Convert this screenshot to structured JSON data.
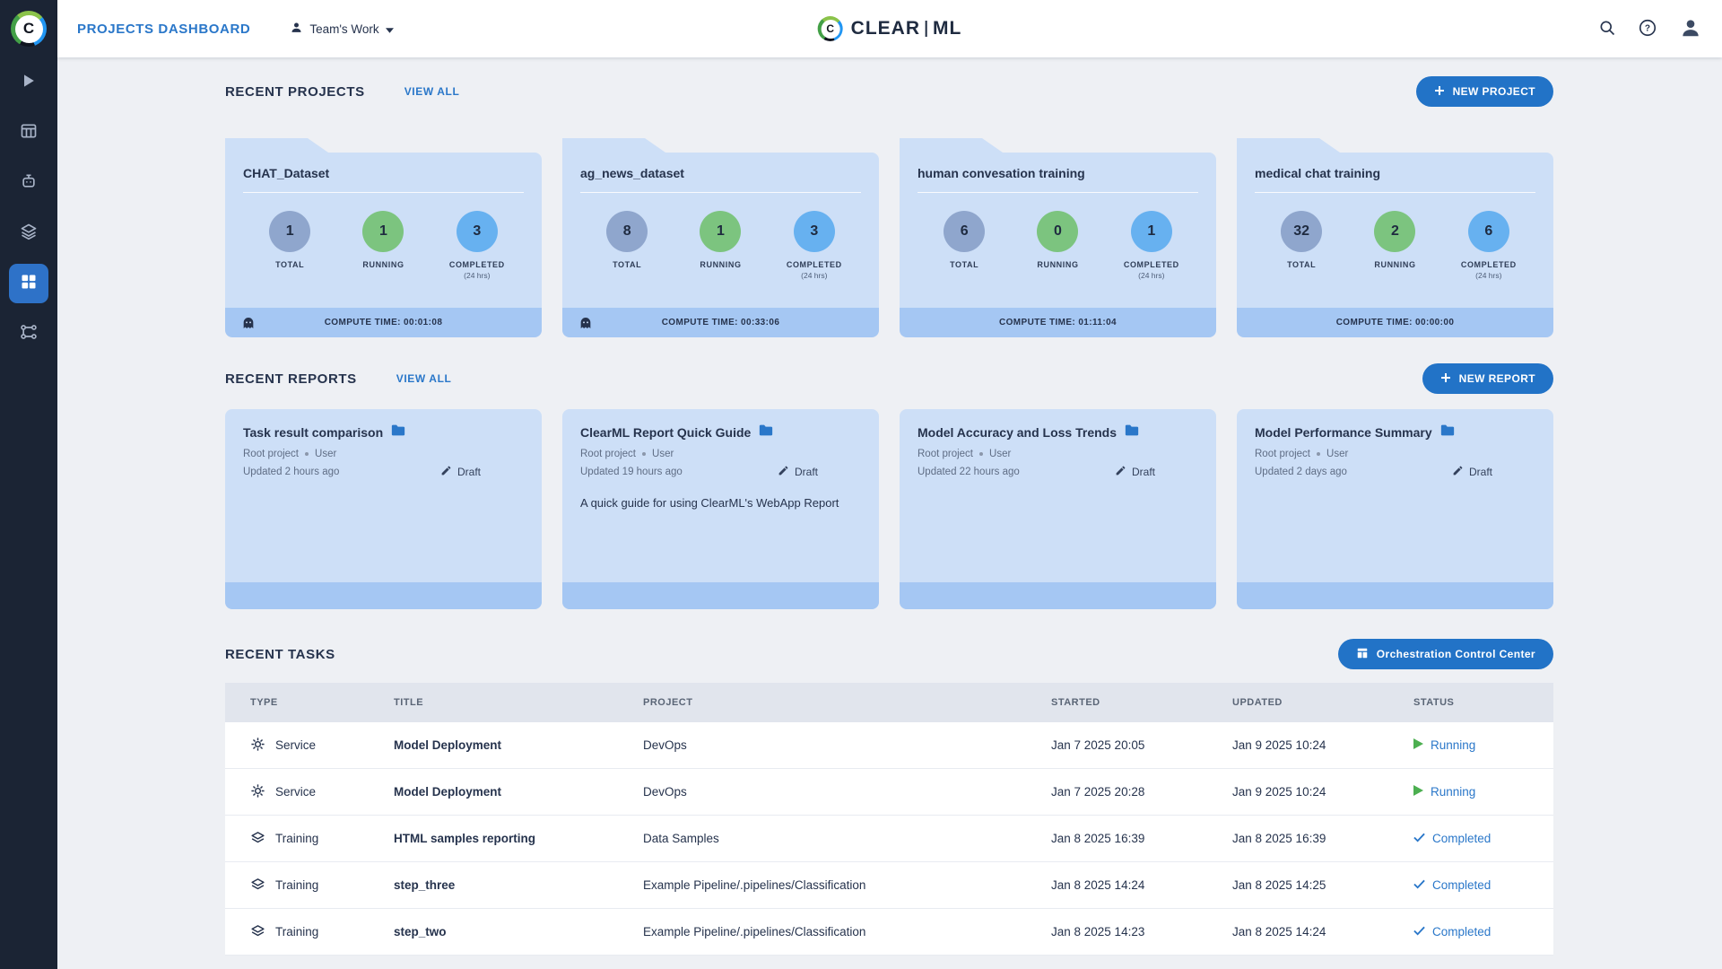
{
  "header": {
    "page_title": "PROJECTS DASHBOARD",
    "workspace": "Team's Work",
    "brand_left": "CLEAR",
    "brand_right": "ML",
    "logo_letter": "C"
  },
  "sidebar": {
    "logo_letter": "C",
    "items": [
      {
        "icon": "dashboard-icon",
        "active": false
      },
      {
        "icon": "projects-icon",
        "active": false
      },
      {
        "icon": "workers-icon",
        "active": false
      },
      {
        "icon": "datasets-icon",
        "active": false
      },
      {
        "icon": "reports-icon",
        "active": true
      },
      {
        "icon": "pipelines-icon",
        "active": false
      }
    ]
  },
  "projects": {
    "title": "RECENT PROJECTS",
    "view_all": "VIEW ALL",
    "new_button": "NEW PROJECT",
    "labels": {
      "total": "TOTAL",
      "running": "RUNNING",
      "completed": "COMPLETED",
      "completed_sub": "(24 hrs)"
    },
    "cards": [
      {
        "name": "CHAT_Dataset",
        "total": "1",
        "running": "1",
        "completed": "3",
        "compute_time": "COMPUTE TIME: 00:01:08"
      },
      {
        "name": "ag_news_dataset",
        "total": "8",
        "running": "1",
        "completed": "3",
        "compute_time": "COMPUTE TIME: 00:33:06"
      },
      {
        "name": "human convesation training",
        "total": "6",
        "running": "0",
        "completed": "1",
        "compute_time": "COMPUTE TIME: 01:11:04"
      },
      {
        "name": "medical chat training",
        "total": "32",
        "running": "2",
        "completed": "6",
        "compute_time": "COMPUTE TIME: 00:00:00"
      }
    ]
  },
  "reports": {
    "title": "RECENT REPORTS",
    "view_all": "VIEW ALL",
    "new_button": "NEW REPORT",
    "cards": [
      {
        "title": "Task result comparison",
        "project": "Root project",
        "author": "User",
        "updated": "Updated 2 hours ago",
        "status": "Draft",
        "description": ""
      },
      {
        "title": "ClearML Report Quick Guide",
        "project": "Root project",
        "author": "User",
        "updated": "Updated 19 hours ago",
        "status": "Draft",
        "description": "A quick guide for using ClearML's WebApp Report"
      },
      {
        "title": "Model Accuracy and Loss Trends",
        "project": "Root project",
        "author": "User",
        "updated": "Updated 22 hours ago",
        "status": "Draft",
        "description": ""
      },
      {
        "title": "Model Performance Summary",
        "project": "Root project",
        "author": "User",
        "updated": "Updated 2 days ago",
        "status": "Draft",
        "description": ""
      }
    ]
  },
  "tasks": {
    "title": "RECENT TASKS",
    "orchestration_button": "Orchestration Control Center",
    "columns": [
      "TYPE",
      "TITLE",
      "PROJECT",
      "STARTED",
      "UPDATED",
      "STATUS"
    ],
    "rows": [
      {
        "type": "Service",
        "title": "Model Deployment",
        "project": "DevOps",
        "started": "Jan 7 2025 20:05",
        "updated": "Jan 9 2025 10:24",
        "status": "Running"
      },
      {
        "type": "Service",
        "title": "Model Deployment",
        "project": "DevOps",
        "started": "Jan 7 2025 20:28",
        "updated": "Jan 9 2025 10:24",
        "status": "Running"
      },
      {
        "type": "Training",
        "title": "HTML samples reporting",
        "project": "Data Samples",
        "started": "Jan 8 2025 16:39",
        "updated": "Jan 8 2025 16:39",
        "status": "Completed"
      },
      {
        "type": "Training",
        "title": "step_three",
        "project": "Example Pipeline/.pipelines/Classification",
        "started": "Jan 8 2025 14:24",
        "updated": "Jan 8 2025 14:25",
        "status": "Completed"
      },
      {
        "type": "Training",
        "title": "step_two",
        "project": "Example Pipeline/.pipelines/Classification",
        "started": "Jan 8 2025 14:23",
        "updated": "Jan 8 2025 14:24",
        "status": "Completed"
      }
    ]
  },
  "colors": {
    "accent_blue": "#2273c7",
    "link_blue": "#2a77c9",
    "card_bg": "#cddff7",
    "card_footer": "#a5c7f3",
    "stat_total": "#8fa6cd",
    "stat_running": "#7cc47f",
    "stat_completed": "#67b1f0",
    "sidebar_bg": "#1b2434",
    "status_green": "#4caf50"
  }
}
